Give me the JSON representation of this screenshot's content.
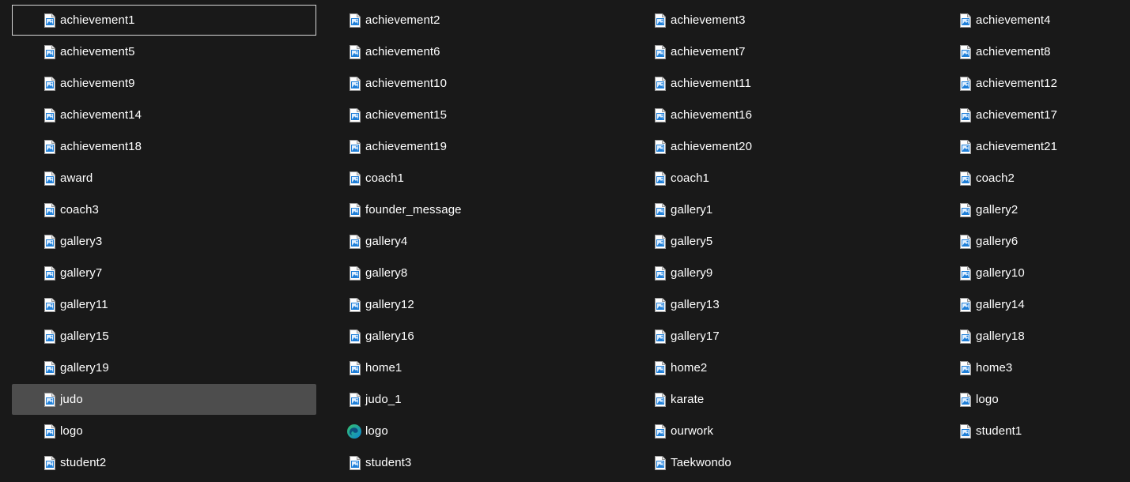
{
  "colors": {
    "background": "#191919",
    "text": "#ffffff",
    "selection": "#4d4d4d",
    "focus_border": "#d8d8d8",
    "image_icon_accent": "#1f7fd8",
    "edge_blue": "#0a84d6",
    "edge_green": "#36c06b"
  },
  "files": [
    {
      "name": "achievement1",
      "icon": "image-file-icon",
      "state": "focused"
    },
    {
      "name": "achievement2",
      "icon": "image-file-icon"
    },
    {
      "name": "achievement3",
      "icon": "image-file-icon"
    },
    {
      "name": "achievement4",
      "icon": "image-file-icon"
    },
    {
      "name": "achievement5",
      "icon": "image-file-icon"
    },
    {
      "name": "achievement6",
      "icon": "image-file-icon"
    },
    {
      "name": "achievement7",
      "icon": "image-file-icon"
    },
    {
      "name": "achievement8",
      "icon": "image-file-icon"
    },
    {
      "name": "achievement9",
      "icon": "image-file-icon"
    },
    {
      "name": "achievement10",
      "icon": "image-file-icon"
    },
    {
      "name": "achievement11",
      "icon": "image-file-icon"
    },
    {
      "name": "achievement12",
      "icon": "image-file-icon"
    },
    {
      "name": "achievement14",
      "icon": "image-file-icon"
    },
    {
      "name": "achievement15",
      "icon": "image-file-icon"
    },
    {
      "name": "achievement16",
      "icon": "image-file-icon"
    },
    {
      "name": "achievement17",
      "icon": "image-file-icon"
    },
    {
      "name": "achievement18",
      "icon": "image-file-icon"
    },
    {
      "name": "achievement19",
      "icon": "image-file-icon"
    },
    {
      "name": "achievement20",
      "icon": "image-file-icon"
    },
    {
      "name": "achievement21",
      "icon": "image-file-icon"
    },
    {
      "name": "award",
      "icon": "image-file-icon"
    },
    {
      "name": "coach1",
      "icon": "image-file-icon"
    },
    {
      "name": "coach1",
      "icon": "image-file-icon"
    },
    {
      "name": "coach2",
      "icon": "image-file-icon"
    },
    {
      "name": "coach3",
      "icon": "image-file-icon"
    },
    {
      "name": "founder_message",
      "icon": "image-file-icon"
    },
    {
      "name": "gallery1",
      "icon": "image-file-icon"
    },
    {
      "name": "gallery2",
      "icon": "image-file-icon"
    },
    {
      "name": "gallery3",
      "icon": "image-file-icon"
    },
    {
      "name": "gallery4",
      "icon": "image-file-icon"
    },
    {
      "name": "gallery5",
      "icon": "image-file-icon"
    },
    {
      "name": "gallery6",
      "icon": "image-file-icon"
    },
    {
      "name": "gallery7",
      "icon": "image-file-icon"
    },
    {
      "name": "gallery8",
      "icon": "image-file-icon"
    },
    {
      "name": "gallery9",
      "icon": "image-file-icon"
    },
    {
      "name": "gallery10",
      "icon": "image-file-icon"
    },
    {
      "name": "gallery11",
      "icon": "image-file-icon"
    },
    {
      "name": "gallery12",
      "icon": "image-file-icon"
    },
    {
      "name": "gallery13",
      "icon": "image-file-icon"
    },
    {
      "name": "gallery14",
      "icon": "image-file-icon"
    },
    {
      "name": "gallery15",
      "icon": "image-file-icon"
    },
    {
      "name": "gallery16",
      "icon": "image-file-icon"
    },
    {
      "name": "gallery17",
      "icon": "image-file-icon"
    },
    {
      "name": "gallery18",
      "icon": "image-file-icon"
    },
    {
      "name": "gallery19",
      "icon": "image-file-icon"
    },
    {
      "name": "home1",
      "icon": "image-file-icon"
    },
    {
      "name": "home2",
      "icon": "image-file-icon"
    },
    {
      "name": "home3",
      "icon": "image-file-icon"
    },
    {
      "name": "judo",
      "icon": "image-file-icon",
      "state": "selected"
    },
    {
      "name": "judo_1",
      "icon": "image-file-icon"
    },
    {
      "name": "karate",
      "icon": "image-file-icon"
    },
    {
      "name": "logo",
      "icon": "image-file-icon"
    },
    {
      "name": "logo",
      "icon": "image-file-icon"
    },
    {
      "name": "logo",
      "icon": "edge-browser-icon"
    },
    {
      "name": "ourwork",
      "icon": "image-file-icon"
    },
    {
      "name": "student1",
      "icon": "image-file-icon"
    },
    {
      "name": "student2",
      "icon": "image-file-icon"
    },
    {
      "name": "student3",
      "icon": "image-file-icon"
    },
    {
      "name": "Taekwondo",
      "icon": "image-file-icon"
    }
  ]
}
